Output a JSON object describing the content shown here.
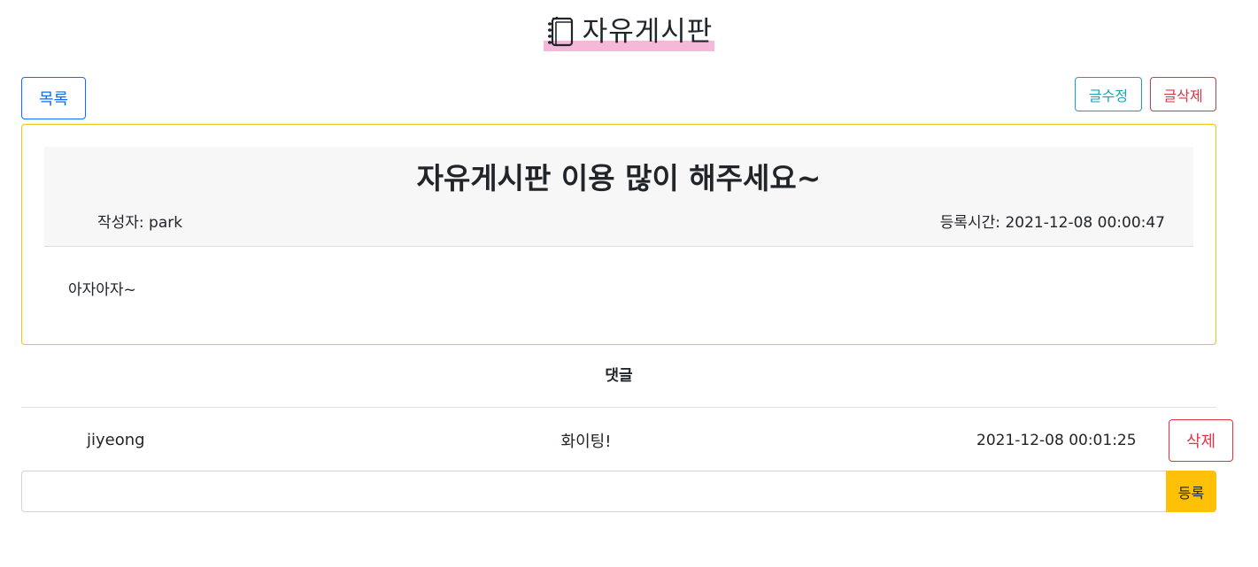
{
  "header": {
    "title": "자유게시판",
    "icon": "notebook-icon",
    "highlight_color": "#f6b8d9"
  },
  "toolbar": {
    "list_label": "목록",
    "edit_label": "글수정",
    "delete_label": "글삭제"
  },
  "post": {
    "title": "자유게시판 이용 많이 해주세요~",
    "author": "작성자: park",
    "created_at": "등록시간: 2021-12-08 00:00:47",
    "body": "아자아자~"
  },
  "comments": {
    "heading": "댓글",
    "items": [
      {
        "author": "jiyeong",
        "text": "화이팅!",
        "time": "2021-12-08 00:01:25",
        "delete_label": "삭제"
      }
    ],
    "input_value": "",
    "submit_label": "등록"
  },
  "colors": {
    "primary": "#0d6efd",
    "info": "#17a2b8",
    "danger": "#dc3545",
    "warning": "#ffc107",
    "card_border": "#f0c419"
  }
}
